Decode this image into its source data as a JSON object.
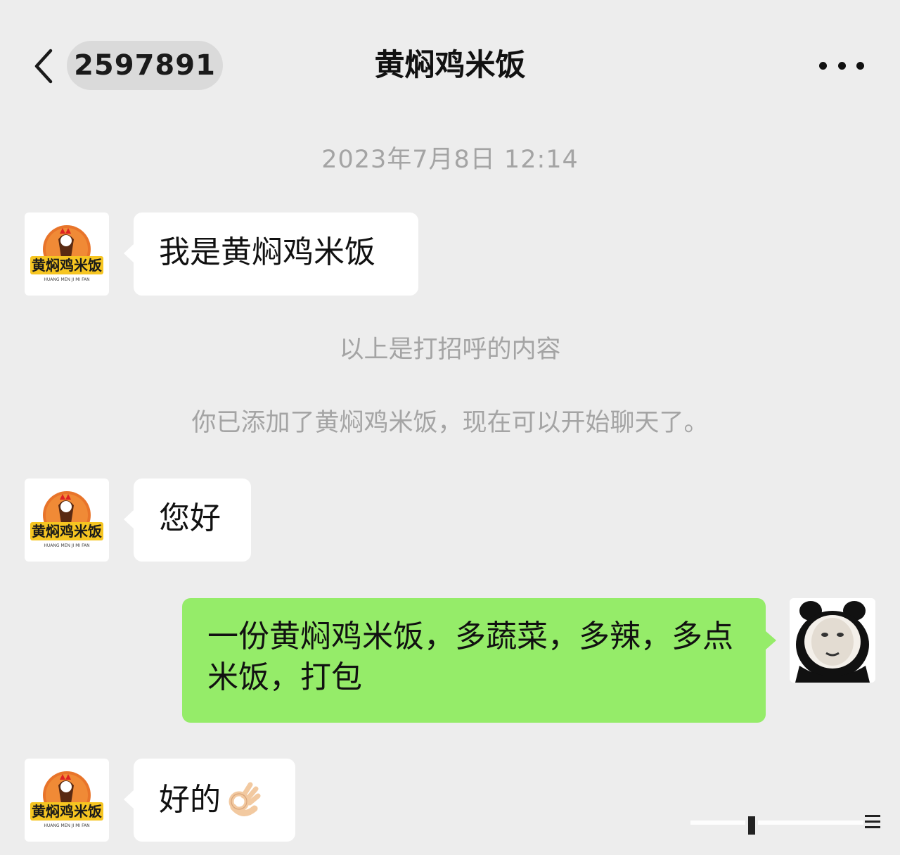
{
  "header": {
    "unread_count": "2597891",
    "title": "黄焖鸡米饭"
  },
  "system": {
    "timestamp": "2023年7月8日 12:14",
    "greeting_note": "以上是打招呼的内容",
    "added_note": "你已添加了黄焖鸡米饭，现在可以开始聊天了。"
  },
  "messages": [
    {
      "sender": "merchant",
      "text": "我是黄焖鸡米饭"
    },
    {
      "sender": "merchant",
      "text": "您好"
    },
    {
      "sender": "me",
      "text": "一份黄焖鸡米饭，多蔬菜，多辣，多点米饭，打包"
    },
    {
      "sender": "merchant",
      "text": "好的"
    }
  ],
  "avatar": {
    "merchant_logo_text": "黄焖鸡米饭",
    "merchant_logo_subtext": "HUANG MEN JI MI FAN"
  },
  "icons": {
    "back": "chevron-left-icon",
    "more": "more-dots-icon",
    "ok_hand": "ok-hand-emoji"
  },
  "colors": {
    "background": "#ededed",
    "my_bubble": "#95ec69",
    "other_bubble": "#ffffff",
    "system_text": "#a4a4a4"
  }
}
